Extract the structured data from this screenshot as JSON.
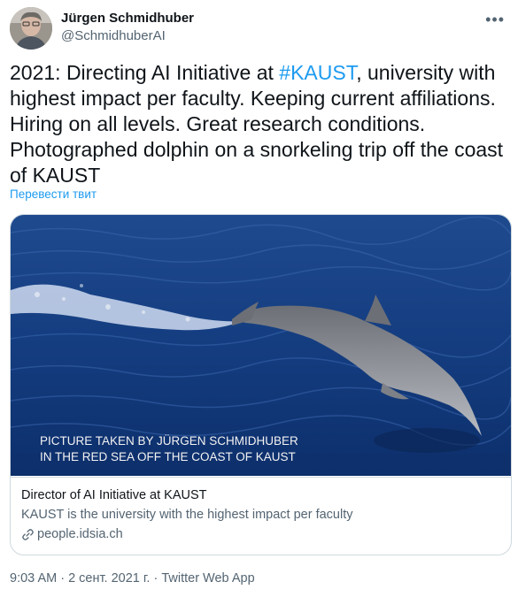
{
  "author": {
    "display_name": "Jürgen Schmidhuber",
    "handle": "@SchmidhuberAI",
    "avatar_icon": "avatar-photo",
    "more_icon": "more-icon"
  },
  "tweet": {
    "text_before": "2021: Directing AI Initiative at ",
    "hashtag": "#KAUST",
    "text_after": ", university with highest impact per faculty. Keeping current affiliations. Hiring on all levels. Great research conditions. Photographed dolphin on a snorkeling trip off the coast of KAUST",
    "translate_label": "Перевести твит"
  },
  "card": {
    "image_caption_line1": "PICTURE TAKEN BY JÜRGEN SCHMIDHUBER",
    "image_caption_line2": "IN THE RED SEA OFF THE COAST OF KAUST",
    "title": "Director of AI Initiative at KAUST",
    "description": "KAUST is the university with the highest impact per faculty",
    "domain": "people.idsia.ch",
    "link_icon": "link-icon"
  },
  "meta": {
    "time": "9:03 AM",
    "separator": " · ",
    "date": "2 сент. 2021 г.",
    "source": "Twitter Web App"
  },
  "colors": {
    "link_blue": "#1d9bf0",
    "secondary_text": "#536471",
    "border": "#cfd9de"
  }
}
